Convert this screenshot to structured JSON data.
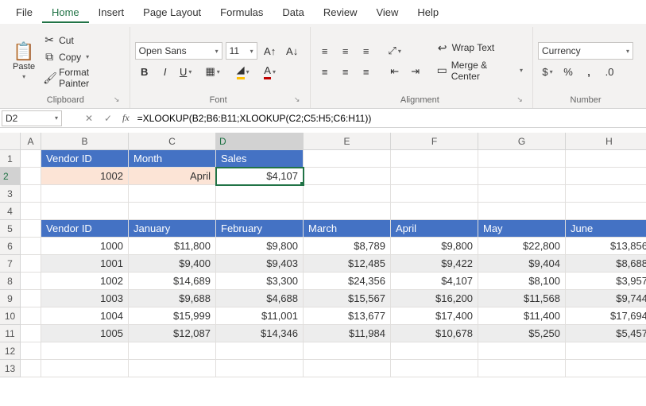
{
  "menu": {
    "tabs": [
      "File",
      "Home",
      "Insert",
      "Page Layout",
      "Formulas",
      "Data",
      "Review",
      "View",
      "Help"
    ],
    "active": "Home"
  },
  "ribbon": {
    "clipboard": {
      "paste": "Paste",
      "cut": "Cut",
      "copy": "Copy",
      "fmt": "Format Painter",
      "label": "Clipboard"
    },
    "font": {
      "name": "Open Sans",
      "size": "11",
      "label": "Font"
    },
    "alignment": {
      "wrap": "Wrap Text",
      "merge": "Merge & Center",
      "label": "Alignment"
    },
    "number": {
      "format": "Currency",
      "label": "Number"
    }
  },
  "namebox": "D2",
  "formula": "=XLOOKUP(B2;B6:B11;XLOOKUP(C2;C5:H5;C6:H11))",
  "fx": "fx",
  "cols": [
    "A",
    "B",
    "C",
    "D",
    "E",
    "F",
    "G",
    "H"
  ],
  "rows": [
    "1",
    "2",
    "3",
    "4",
    "5",
    "6",
    "7",
    "8",
    "9",
    "10",
    "11",
    "12",
    "13"
  ],
  "r1": {
    "b": "Vendor ID",
    "c": "Month",
    "d": "Sales"
  },
  "r2": {
    "b": "1002",
    "c": "April",
    "d": "$4,107"
  },
  "r5": {
    "b": "Vendor ID",
    "c": "January",
    "d": "February",
    "e": "March",
    "f": "April",
    "g": "May",
    "h": "June"
  },
  "r6": {
    "b": "1000",
    "c": "$11,800",
    "d": "$9,800",
    "e": "$8,789",
    "f": "$9,800",
    "g": "$22,800",
    "h": "$13,856"
  },
  "r7": {
    "b": "1001",
    "c": "$9,400",
    "d": "$9,403",
    "e": "$12,485",
    "f": "$9,422",
    "g": "$9,404",
    "h": "$8,688"
  },
  "r8": {
    "b": "1002",
    "c": "$14,689",
    "d": "$3,300",
    "e": "$24,356",
    "f": "$4,107",
    "g": "$8,100",
    "h": "$3,957"
  },
  "r9": {
    "b": "1003",
    "c": "$9,688",
    "d": "$4,688",
    "e": "$15,567",
    "f": "$16,200",
    "g": "$11,568",
    "h": "$9,744"
  },
  "r10": {
    "b": "1004",
    "c": "$15,999",
    "d": "$11,001",
    "e": "$13,677",
    "f": "$17,400",
    "g": "$11,400",
    "h": "$17,694"
  },
  "r11": {
    "b": "1005",
    "c": "$12,087",
    "d": "$14,346",
    "e": "$11,984",
    "f": "$10,678",
    "g": "$5,250",
    "h": "$5,457"
  }
}
